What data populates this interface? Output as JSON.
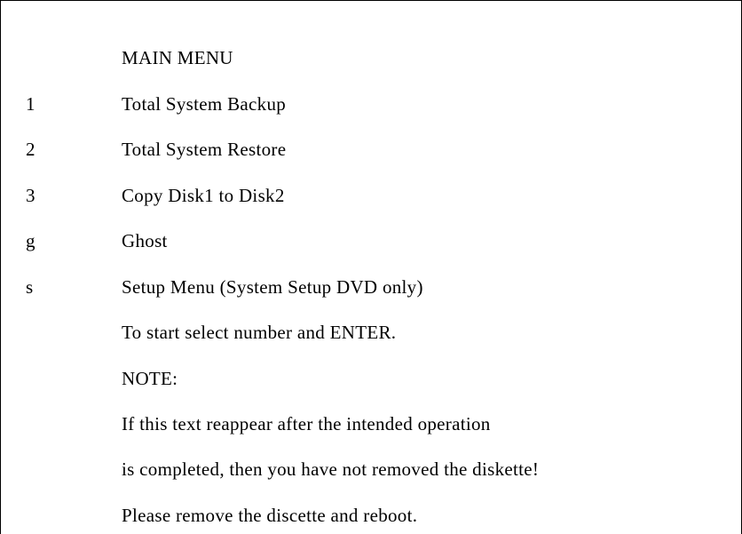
{
  "title": "MAIN MENU",
  "items": [
    {
      "key": "1",
      "label": "Total System Backup"
    },
    {
      "key": "2",
      "label": "Total System Restore"
    },
    {
      "key": "3",
      "label": "Copy Disk1 to Disk2"
    },
    {
      "key": "g",
      "label": "Ghost"
    },
    {
      "key": "s",
      "label": "Setup Menu (System Setup DVD only)"
    }
  ],
  "instruction": "To start select number and ENTER.",
  "note_heading": "NOTE:",
  "note_lines": [
    "If this text reappear after the intended operation",
    "is completed, then you have not removed the diskette!",
    "Please remove the discette and reboot."
  ]
}
